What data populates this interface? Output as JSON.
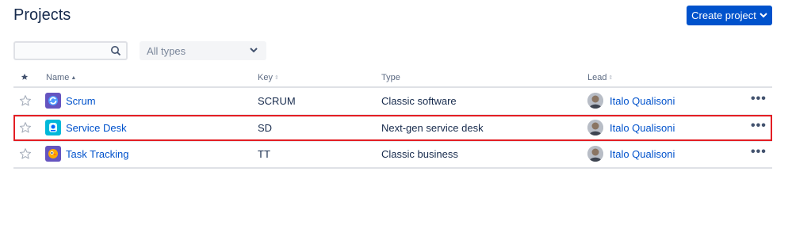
{
  "page": {
    "title": "Projects"
  },
  "toolbar": {
    "create_label": "Create project"
  },
  "filters": {
    "search_placeholder": "",
    "type_selected": "All types"
  },
  "table": {
    "headers": {
      "name": "Name",
      "key": "Key",
      "type": "Type",
      "lead": "Lead"
    },
    "rows": [
      {
        "name": "Scrum",
        "key": "SCRUM",
        "type": "Classic software",
        "lead": "Italo Qualisoni",
        "icon": "scrum-project-icon",
        "icon_color": "#6554C0"
      },
      {
        "name": "Service Desk",
        "key": "SD",
        "type": "Next-gen service desk",
        "lead": "Italo Qualisoni",
        "icon": "service-desk-project-icon",
        "icon_color": "#00B8D9",
        "highlighted": true
      },
      {
        "name": "Task Tracking",
        "key": "TT",
        "type": "Classic business",
        "lead": "Italo Qualisoni",
        "icon": "task-tracking-project-icon",
        "icon_color": "#6554C0"
      }
    ]
  },
  "colors": {
    "accent": "#0052CC",
    "highlight_border": "#E31E24",
    "link": "#0052CC"
  }
}
